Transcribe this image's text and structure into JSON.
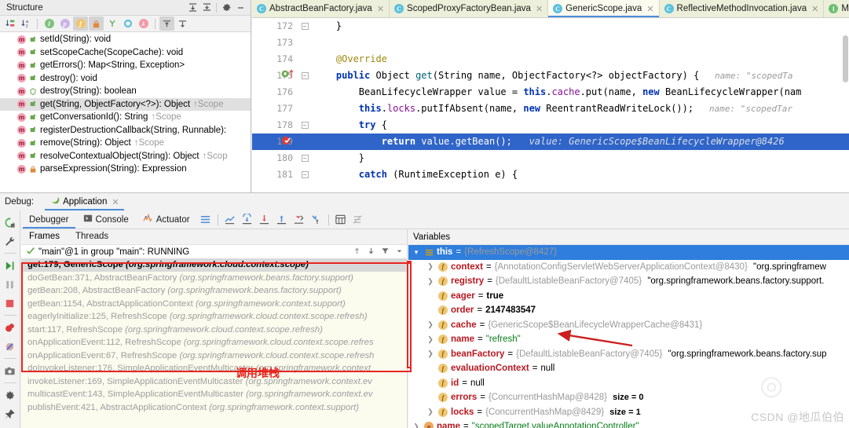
{
  "structure": {
    "title": "Structure",
    "header_icons": [
      "expand-all-icon",
      "collapse-all-icon",
      "gear-icon",
      "minimize-icon"
    ],
    "toolbar_icons": [
      "sort-by-visibility-icon",
      "sort-alphabetically-icon",
      "inherited-members-icon",
      "properties-icon",
      "fields-icon",
      "non-public-icon",
      "anonymous-classes-icon",
      "interfaces-icon",
      "lambdas-icon",
      "scroll-from-source-icon",
      "scroll-to-source-icon"
    ],
    "items": [
      {
        "icon": "method-icon",
        "visibility": "public",
        "label": "setId(String): void",
        "sup": "",
        "selected": false
      },
      {
        "icon": "method-icon",
        "visibility": "public",
        "label": "setScopeCache(ScopeCache): void",
        "sup": "",
        "selected": false
      },
      {
        "icon": "method-icon",
        "visibility": "public",
        "label": "getErrors(): Map<String, Exception>",
        "sup": "",
        "selected": false
      },
      {
        "icon": "method-icon",
        "visibility": "public",
        "label": "destroy(): void",
        "sup": "",
        "selected": false
      },
      {
        "icon": "method-icon",
        "visibility": "protected",
        "label": "destroy(String): boolean",
        "sup": "",
        "selected": false
      },
      {
        "icon": "method-icon",
        "visibility": "public",
        "label": "get(String, ObjectFactory<?>): Object",
        "sup": "↑Scope",
        "selected": true
      },
      {
        "icon": "method-icon",
        "visibility": "public",
        "label": "getConversationId(): String",
        "sup": "↑Scope",
        "selected": false
      },
      {
        "icon": "method-icon",
        "visibility": "public",
        "label": "registerDestructionCallback(String, Runnable):",
        "sup": "",
        "selected": false
      },
      {
        "icon": "method-icon",
        "visibility": "public",
        "label": "remove(String): Object",
        "sup": "↑Scope",
        "selected": false
      },
      {
        "icon": "method-icon",
        "visibility": "public",
        "label": "resolveContextualObject(String): Object",
        "sup": "↑Scop",
        "selected": false
      },
      {
        "icon": "method-icon",
        "visibility": "private",
        "label": "parseExpression(String): Expression",
        "sup": "",
        "selected": false
      }
    ]
  },
  "editor": {
    "tabs": [
      {
        "icon": "class-icon",
        "label": "AbstractBeanFactory.java",
        "active": false,
        "closable": true
      },
      {
        "icon": "class-icon",
        "label": "ScopedProxyFactoryBean.java",
        "active": false,
        "closable": true
      },
      {
        "icon": "class-icon",
        "label": "GenericScope.java",
        "active": true,
        "closable": true
      },
      {
        "icon": "class-icon",
        "label": "ReflectiveMethodInvocation.java",
        "active": false,
        "closable": true
      },
      {
        "icon": "interface-icon",
        "label": "MethodInterceptor",
        "active": false,
        "closable": false
      }
    ],
    "lines": [
      {
        "num": "172",
        "indent": 1,
        "code": "}",
        "hint": "",
        "state": "normal",
        "fold": "collapse",
        "gutter": ""
      },
      {
        "num": "173",
        "indent": 0,
        "code": "",
        "hint": "",
        "state": "normal",
        "fold": "",
        "gutter": ""
      },
      {
        "num": "174",
        "indent": 1,
        "code": "@Override",
        "hint": "",
        "state": "normal",
        "fold": "",
        "gutter": ""
      },
      {
        "num": "175",
        "indent": 1,
        "code": "public Object get(String name, ObjectFactory<?> objectFactory) {",
        "hint": "name: \"scopedTa",
        "state": "normal",
        "fold": "collapse",
        "gutter": "override-impl-icon"
      },
      {
        "num": "176",
        "indent": 2,
        "code": "BeanLifecycleWrapper value = this.cache.put(name, new BeanLifecycleWrapper(nam",
        "hint": "",
        "state": "normal",
        "fold": "",
        "gutter": ""
      },
      {
        "num": "177",
        "indent": 2,
        "code": "this.locks.putIfAbsent(name, new ReentrantReadWriteLock());",
        "hint": "name: \"scopedTar",
        "state": "normal",
        "fold": "",
        "gutter": ""
      },
      {
        "num": "178",
        "indent": 2,
        "code": "try {",
        "hint": "",
        "state": "normal",
        "fold": "collapse",
        "gutter": ""
      },
      {
        "num": "179",
        "indent": 3,
        "code": "return value.getBean();",
        "hint": "value: GenericScope$BeanLifecycleWrapper@8426",
        "state": "selected",
        "fold": "",
        "gutter": "breakpoint-hit-icon"
      },
      {
        "num": "180",
        "indent": 2,
        "code": "}",
        "hint": "",
        "state": "normal",
        "fold": "collapse",
        "gutter": ""
      },
      {
        "num": "181",
        "indent": 2,
        "code": "catch (RuntimeException e) {",
        "hint": "",
        "state": "cut",
        "fold": "collapse",
        "gutter": ""
      }
    ]
  },
  "debug": {
    "label": "Debug:",
    "app_tab": {
      "icon": "spring-boot-icon",
      "label": "Application"
    },
    "rail_icons": [
      "rerun-icon",
      "wrench-settings-icon",
      "resume-program-icon",
      "pause-program-icon",
      "stop-icon",
      "view-breakpoints-icon",
      "mute-breakpoints-icon",
      "camera-snapshot-icon",
      "settings-gear-icon",
      "pin-icon"
    ],
    "tabs": [
      {
        "icon": "debugger-icon",
        "label": "Debugger",
        "active": true
      },
      {
        "icon": "console-icon",
        "label": "Console",
        "active": false
      },
      {
        "icon": "actuator-icon",
        "label": "Actuator",
        "active": false
      }
    ],
    "toolbar_icons": [
      "layout-settings-icon",
      "show-execution-point-icon",
      "step-over-icon",
      "step-into-icon",
      "force-step-into-icon",
      "step-out-icon",
      "drop-frame-icon",
      "run-to-cursor-icon",
      "evaluate-expression-icon",
      "mute-breakpoints-icon"
    ],
    "frames": {
      "tabs": [
        {
          "label": "Frames",
          "active": true
        },
        {
          "label": "Threads",
          "active": false
        }
      ],
      "thread": "\"main\"@1 in group \"main\": RUNNING",
      "nav_icons": [
        "up-arrow-icon",
        "down-arrow-icon",
        "filter-icon",
        "dropdown-icon"
      ],
      "items": [
        {
          "method": "get:179, GenericScope",
          "pkg": "(org.springframework.cloud.context.scope)",
          "selected": true
        },
        {
          "method": "doGetBean:371, AbstractBeanFactory",
          "pkg": "(org.springframework.beans.factory.support)",
          "selected": false
        },
        {
          "method": "getBean:208, AbstractBeanFactory",
          "pkg": "(org.springframework.beans.factory.support)",
          "selected": false
        },
        {
          "method": "getBean:1154, AbstractApplicationContext",
          "pkg": "(org.springframework.context.support)",
          "selected": false
        },
        {
          "method": "eagerlyInitialize:125, RefreshScope",
          "pkg": "(org.springframework.cloud.context.scope.refresh)",
          "selected": false
        },
        {
          "method": "start:117, RefreshScope",
          "pkg": "(org.springframework.cloud.context.scope.refresh)",
          "selected": false
        },
        {
          "method": "onApplicationEvent:112, RefreshScope",
          "pkg": "(org.springframework.cloud.context.scope.refres",
          "selected": false
        },
        {
          "method": "onApplicationEvent:67, RefreshScope",
          "pkg": "(org.springframework.cloud.context.scope.refresh",
          "selected": false
        },
        {
          "method": "doInvokeListener:176, SimpleApplicationEventMulticaster",
          "pkg": "(org.springframework.context",
          "selected": false
        },
        {
          "method": "invokeListener:169, SimpleApplicationEventMulticaster",
          "pkg": "(org.springframework.context.ev",
          "selected": false
        },
        {
          "method": "multicastEvent:143, SimpleApplicationEventMulticaster",
          "pkg": "(org.springframework.context.ev",
          "selected": false
        },
        {
          "method": "publishEvent:421, AbstractApplicationContext",
          "pkg": "(org.springframework.context.support)",
          "selected": false
        }
      ]
    },
    "variables": {
      "header": "Variables",
      "rows": [
        {
          "chev": "v",
          "icon": "this-icon",
          "name": "this",
          "eq": " = ",
          "value": "{RefreshScope@8427}",
          "vtype": "obj",
          "extra": "",
          "selected": true,
          "indent": 0
        },
        {
          "chev": ">",
          "icon": "field-icon",
          "name": "context",
          "eq": " = ",
          "value": "{AnnotationConfigServletWebServerApplicationContext@8430}",
          "vtype": "obj",
          "extra": "\"org.springframew",
          "selected": false,
          "indent": 1
        },
        {
          "chev": ">",
          "icon": "field-icon",
          "name": "registry",
          "eq": " = ",
          "value": "{DefaultListableBeanFactory@7405}",
          "vtype": "obj",
          "extra": "\"org.springframework.beans.factory.support.",
          "selected": false,
          "indent": 1
        },
        {
          "chev": "",
          "icon": "field-icon",
          "name": "eager",
          "eq": " = ",
          "value": "true",
          "vtype": "num",
          "extra": "",
          "selected": false,
          "indent": 1
        },
        {
          "chev": "",
          "icon": "field-icon",
          "name": "order",
          "eq": " = ",
          "value": "2147483547",
          "vtype": "num",
          "extra": "",
          "selected": false,
          "indent": 1
        },
        {
          "chev": ">",
          "icon": "field-icon",
          "name": "cache",
          "eq": " = ",
          "value": "{GenericScope$BeanLifecycleWrapperCache@8431}",
          "vtype": "obj",
          "extra": "",
          "selected": false,
          "indent": 1
        },
        {
          "chev": ">",
          "icon": "field-icon",
          "name": "name",
          "eq": " = ",
          "value": "\"refresh\"",
          "vtype": "str",
          "extra": "",
          "selected": false,
          "indent": 1
        },
        {
          "chev": ">",
          "icon": "field-icon",
          "name": "beanFactory",
          "eq": " = ",
          "value": "{DefaultListableBeanFactory@7405}",
          "vtype": "obj",
          "extra": "\"org.springframework.beans.factory.sup",
          "selected": false,
          "indent": 1
        },
        {
          "chev": "",
          "icon": "field-icon",
          "name": "evaluationContext",
          "eq": " = ",
          "value": "null",
          "vtype": "null",
          "extra": "",
          "selected": false,
          "indent": 1
        },
        {
          "chev": "",
          "icon": "field-icon",
          "name": "id",
          "eq": " = ",
          "value": "null",
          "vtype": "null",
          "extra": "",
          "selected": false,
          "indent": 1
        },
        {
          "chev": "",
          "icon": "field-icon",
          "name": "errors",
          "eq": " = ",
          "value": "{ConcurrentHashMap@8428}",
          "vtype": "obj",
          "extra": "size = 0",
          "selected": false,
          "indent": 1
        },
        {
          "chev": ">",
          "icon": "field-icon",
          "name": "locks",
          "eq": " = ",
          "value": "{ConcurrentHashMap@8429}",
          "vtype": "obj",
          "extra": "size = 1",
          "selected": false,
          "indent": 1
        },
        {
          "chev": ">",
          "icon": "param-icon",
          "name": "name",
          "eq": " = ",
          "value": "\"scopedTarget.valueAnnotationController\"",
          "vtype": "str",
          "extra": "",
          "selected": false,
          "indent": 0
        }
      ]
    }
  },
  "annotations": {
    "callstack_label": "调用堆栈",
    "callstack_color": "#e8251f",
    "watermark": "CSDN @地瓜伯伯",
    "highlight_color": "#e8251f"
  }
}
